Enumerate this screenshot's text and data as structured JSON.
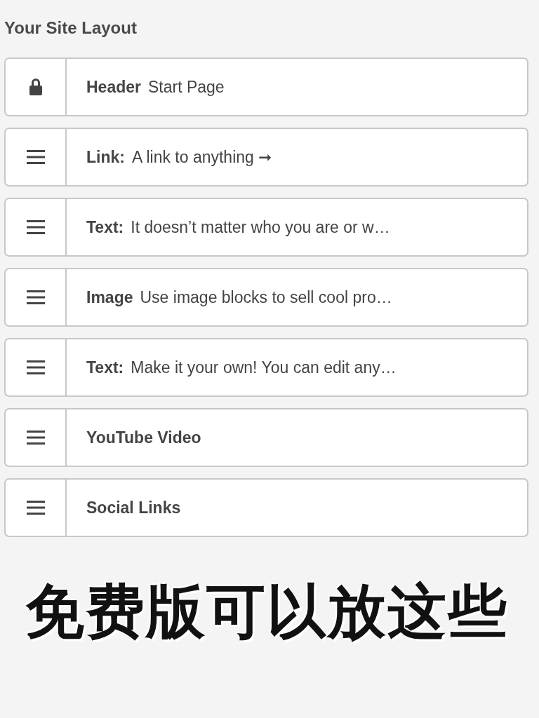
{
  "title": "Your Site Layout",
  "blocks": [
    {
      "kind": "locked",
      "label": "Header",
      "text": "Start Page"
    },
    {
      "kind": "draggable",
      "label": "Link:",
      "text": "A link to anything ➞"
    },
    {
      "kind": "draggable",
      "label": "Text:",
      "text": "It doesn’t matter who you are or w…"
    },
    {
      "kind": "draggable",
      "label": "Image",
      "text": "Use image blocks to sell cool pro…"
    },
    {
      "kind": "draggable",
      "label": "Text:",
      "text": "Make it your own! You can edit any…"
    },
    {
      "kind": "draggable",
      "label": "YouTube Video"
    },
    {
      "kind": "draggable",
      "label": "Social Links"
    }
  ],
  "caption": "免费版可以放这些"
}
